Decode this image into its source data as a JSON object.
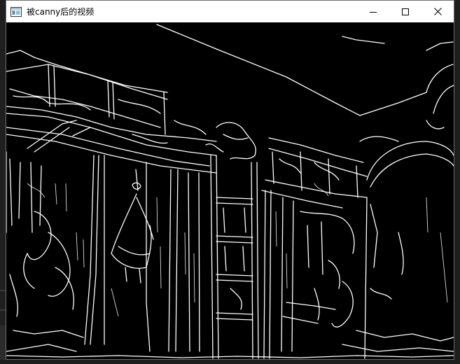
{
  "window": {
    "title": "被canny后的视频",
    "app_icon": "window-app-icon",
    "controls": {
      "minimize_icon": "minimize-icon",
      "maximize_icon": "maximize-icon",
      "close_icon": "close-icon"
    }
  },
  "content": {
    "description_icon": "canny-edge-frame",
    "background_color": "#000000",
    "edge_color": "#ffffff"
  }
}
